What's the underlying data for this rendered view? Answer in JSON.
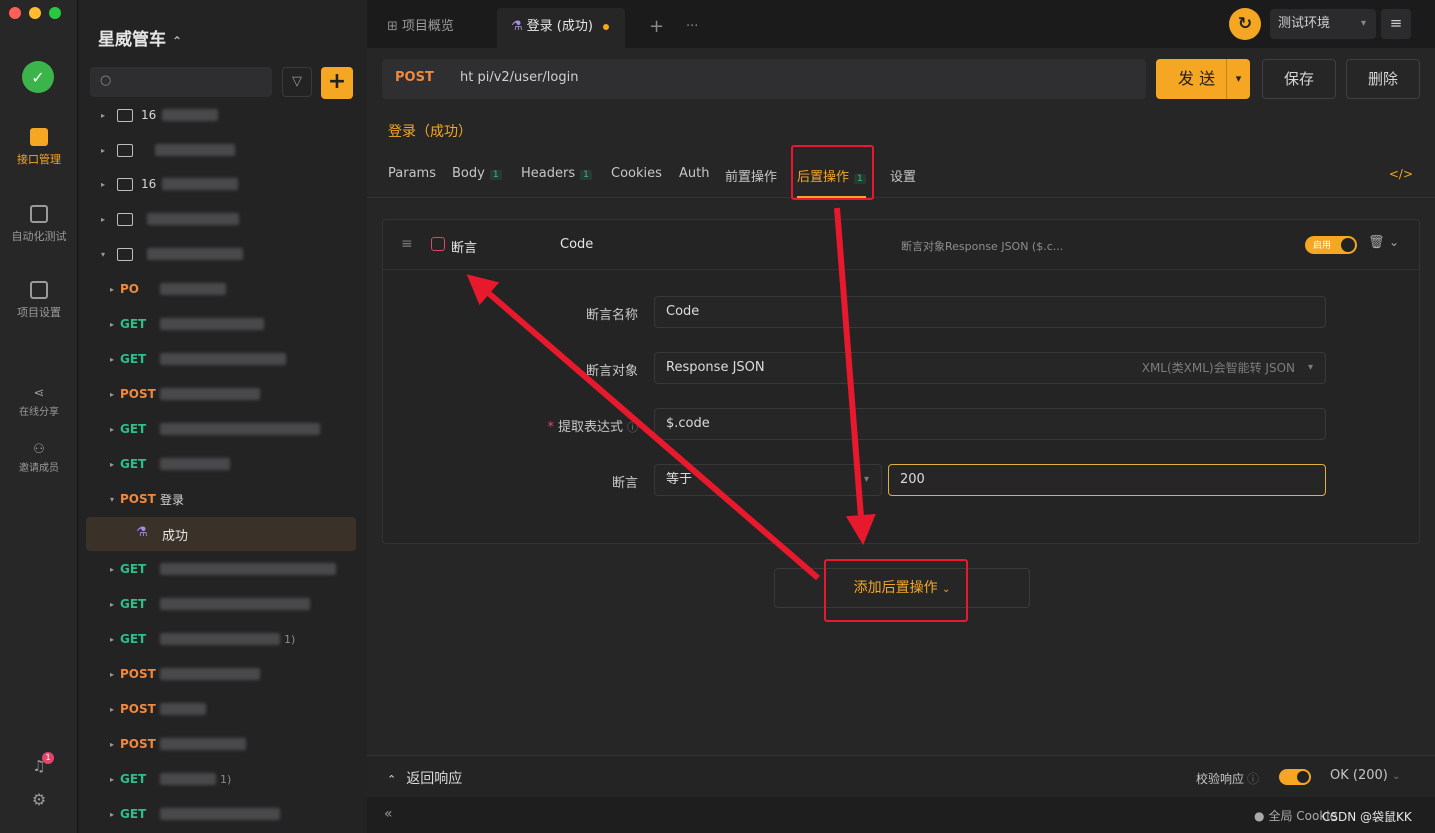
{
  "project": {
    "name": "星威管车",
    "switch_glyph": "⌃⌄"
  },
  "rail": [
    {
      "label": "接口管理",
      "active": true
    },
    {
      "label": "自动化测试",
      "active": false
    },
    {
      "label": "项目设置",
      "active": false
    },
    {
      "label": "在线分享",
      "active": false
    },
    {
      "label": "邀请成员",
      "active": false
    }
  ],
  "notification_count": "1",
  "tree": {
    "folders": [
      {
        "prefix": "16"
      },
      {
        "prefix": ""
      },
      {
        "prefix": "16"
      },
      {
        "prefix": ""
      },
      {
        "prefix": ""
      }
    ],
    "requests": [
      {
        "method": "PO",
        "label": ""
      },
      {
        "method": "GET",
        "label": ""
      },
      {
        "method": "GET",
        "label": ""
      },
      {
        "method": "POST",
        "label": ""
      },
      {
        "method": "GET",
        "label": ""
      },
      {
        "method": "GET",
        "label": ""
      },
      {
        "method": "POST",
        "label": "登录"
      },
      {
        "method": "GET",
        "label": ""
      },
      {
        "method": "GET",
        "label": ""
      },
      {
        "method": "GET",
        "label": "1)"
      },
      {
        "method": "POST",
        "label": ""
      },
      {
        "method": "POST",
        "label": ""
      },
      {
        "method": "POST",
        "label": ""
      },
      {
        "method": "GET",
        "label": "1)"
      },
      {
        "method": "GET",
        "label": ""
      }
    ],
    "selected_case": "成功"
  },
  "tabs": [
    {
      "label": "项目概览"
    },
    {
      "label": "登录 (成功)"
    }
  ],
  "tab_add": "+",
  "tab_more": "···",
  "env": {
    "label": "测试环境"
  },
  "request": {
    "method": "POST",
    "url": "ht                                    pi/v2/user/login",
    "send": "发 送",
    "save": "保存",
    "delete": "删除"
  },
  "breadcrumb": "登录（成功）",
  "subtabs": [
    {
      "label": "Params",
      "count": ""
    },
    {
      "label": "Body",
      "count": "1"
    },
    {
      "label": "Headers",
      "count": "1"
    },
    {
      "label": "Cookies",
      "count": ""
    },
    {
      "label": "Auth",
      "count": ""
    },
    {
      "label": "前置操作",
      "count": ""
    },
    {
      "label": "后置操作",
      "count": "1"
    },
    {
      "label": "设置",
      "count": ""
    }
  ],
  "assertion": {
    "type": "断言",
    "name": "Code",
    "summary": "断言对象Response JSON ($.c...",
    "enabled_label": "启用",
    "fields": {
      "name_label": "断言名称",
      "name_value": "Code",
      "target_label": "断言对象",
      "target_value": "Response JSON",
      "target_hint": "XML(类XML)会智能转 JSON",
      "expr_label": "提取表达式",
      "expr_value": "$.code",
      "op_label": "断言",
      "op_value": "等于",
      "expected_value": "200"
    }
  },
  "add_post_action": "添加后置操作",
  "response": {
    "title": "返回响应",
    "verify_label": "校验响应",
    "status": "OK (200)"
  },
  "footer": {
    "global": "全局 Cookie",
    "watermark": "CSDN @袋鼠KK"
  },
  "colors": {
    "accent": "#f5a623",
    "get": "#2dbf8a",
    "post": "#f0883e",
    "annotation": "#e8192c"
  }
}
